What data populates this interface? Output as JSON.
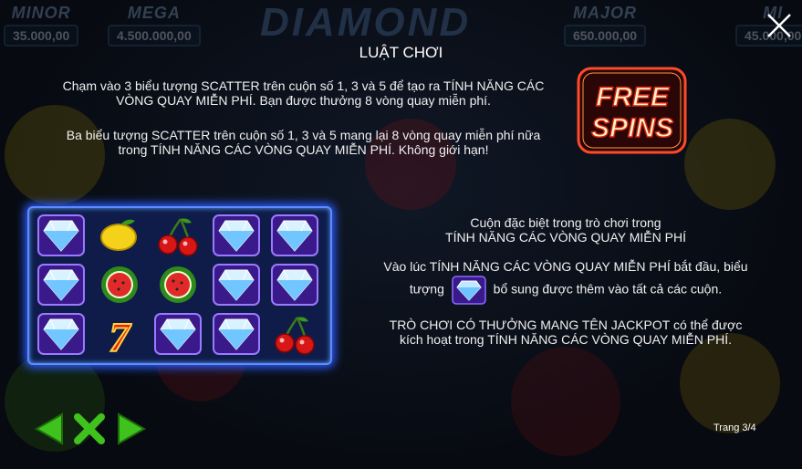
{
  "header": {
    "title": "LUẬT CHƠI",
    "logo_text": "DIAMOND",
    "jackpots": [
      {
        "label": "MINOR",
        "value": "35.000,00"
      },
      {
        "label": "MEGA",
        "value": "4.500.000,00"
      },
      {
        "label": "MAJOR",
        "value": "650.000,00"
      },
      {
        "label": "MI",
        "value": "45.000,00"
      }
    ]
  },
  "badge": {
    "line1": "FREE",
    "line2": "SPINS"
  },
  "paragraphs": {
    "p1": "Chạm vào 3 biểu tượng SCATTER trên cuộn số 1, 3 và 5 để tạo ra TÍNH NĂNG CÁC VÒNG QUAY MIỄN PHÍ. Bạn được thưởng 8 vòng quay miễn phí.",
    "p2": "Ba biểu tượng SCATTER trên cuộn số 1, 3 và 5 mang lại 8 vòng quay miễn phí nữa trong TÍNH NĂNG CÁC VÒNG QUAY MIỄN PHÍ. Không giới hạn!",
    "p3a": "Cuộn đặc biệt trong trò chơi trong",
    "p3b": "TÍNH NĂNG CÁC VÒNG QUAY MIỄN PHÍ",
    "p4a": "Vào lúc TÍNH NĂNG CÁC VÒNG QUAY MIỄN PHÍ bắt đầu, biểu",
    "p4b_pre": "tượng",
    "p4b_post": "bổ sung được thêm vào tất cả các cuộn.",
    "p5a": "TRÒ CHƠI CÓ THƯỞNG MANG TÊN JACKPOT có thể được",
    "p5b": "kích hoạt trong TÍNH NĂNG CÁC VÒNG QUAY MIỄN PHÍ."
  },
  "reels": [
    [
      "diamond",
      "lemon",
      "cherry",
      "diamond",
      "diamond"
    ],
    [
      "diamond",
      "watermelon",
      "watermelon",
      "diamond",
      "diamond"
    ],
    [
      "diamond",
      "seven",
      "diamond",
      "diamond",
      "cherry"
    ]
  ],
  "footer": {
    "page": "Trang 3/4"
  },
  "colors": {
    "nav_green": "#3fc21e",
    "grid_glow": "#2c5cff",
    "badge_red": "#e0201c"
  }
}
